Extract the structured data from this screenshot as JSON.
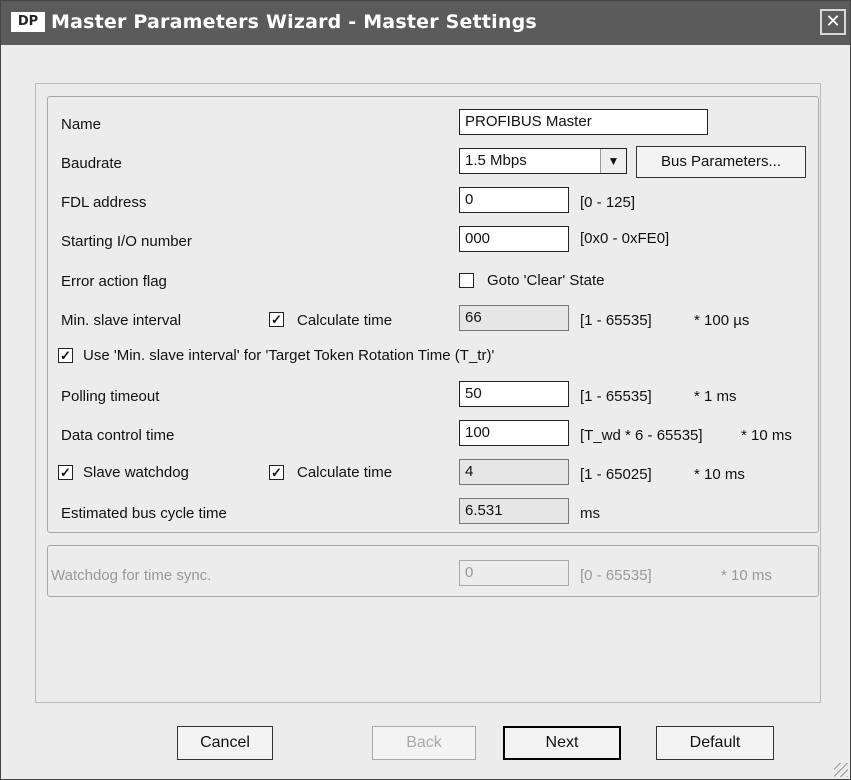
{
  "window": {
    "icon_text": "DP",
    "title": "Master Parameters Wizard - Master Settings",
    "close_glyph": "✕"
  },
  "settings": {
    "name": {
      "label": "Name",
      "value": "PROFIBUS Master"
    },
    "baudrate": {
      "label": "Baudrate",
      "value": "1.5 Mbps",
      "bus_params_button": "Bus Parameters..."
    },
    "fdl_address": {
      "label": "FDL address",
      "value": "0",
      "range": "[0 - 125]"
    },
    "starting_io": {
      "label": "Starting I/O number",
      "value": "000",
      "range": "[0x0 - 0xFE0]"
    },
    "error_action": {
      "label": "Error action flag",
      "checkbox_label": "Goto 'Clear' State",
      "checked": false
    },
    "min_slave_interval": {
      "label": "Min. slave interval",
      "calc_label": "Calculate time",
      "calc_checked": true,
      "value": "66",
      "range": "[1 - 65535]",
      "unit": "* 100 µs"
    },
    "use_min_slave": {
      "label": "Use 'Min. slave interval' for 'Target Token Rotation Time (T_tr)'",
      "checked": true
    },
    "polling_timeout": {
      "label": "Polling timeout",
      "value": "50",
      "range": "[1 - 65535]",
      "unit": "* 1 ms"
    },
    "data_control": {
      "label": "Data control time",
      "value": "100",
      "range": "[T_wd * 6 - 65535]",
      "unit": "* 10 ms"
    },
    "slave_watchdog": {
      "label": "Slave watchdog",
      "checked": true,
      "calc_label": "Calculate time",
      "calc_checked": true,
      "value": "4",
      "range": "[1 - 65025]",
      "unit": "* 10 ms"
    },
    "bus_cycle": {
      "label": "Estimated bus cycle time",
      "value": "6.531",
      "unit": "ms"
    }
  },
  "time_sync": {
    "label": "Watchdog for time sync.",
    "value": "0",
    "range": "[0 - 65535]",
    "unit": "* 10 ms"
  },
  "buttons": {
    "cancel": "Cancel",
    "back": "Back",
    "next": "Next",
    "default": "Default"
  },
  "glyphs": {
    "check": "✓",
    "dropdown": "▼"
  }
}
